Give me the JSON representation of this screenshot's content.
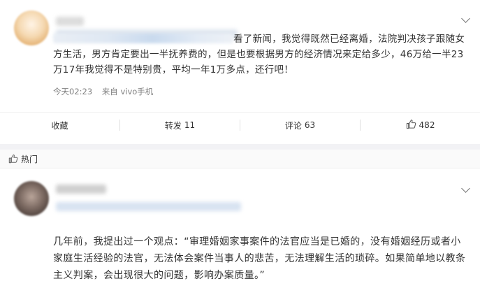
{
  "post": {
    "text_visible": "看了新闻，我觉得既然已经离婚，法院判决孩子跟随女方生活，男方肯定要出一半抚养费的，但是也要根据男方的经济情况来定给多少，46万给一半23万17年我觉得不是特别贵，平均一年1万多点，还行吧！",
    "time": "今天02:23",
    "source": "来自 vivo手机"
  },
  "actions": {
    "favorite_label": "收藏",
    "repost_label": "转发",
    "repost_count": "11",
    "comment_label": "评论",
    "comment_count": "63",
    "like_count": "482"
  },
  "hot_section": {
    "label": "热门"
  },
  "comment": {
    "text": "几年前，我提出过一个观点：“审理婚姻家事案件的法官应当是已婚的，没有婚姻经历或者小家庭生活经验的法官，无法体会案件当事人的悲苦，无法理解生活的琐碎。如果简单地以教条主义判案，会出现很大的问题，影响办案质量。”"
  },
  "icons": {
    "menu": "chevron-down-icon",
    "like": "thumbs-up-icon",
    "hot": "thumbs-up-icon"
  },
  "colors": {
    "text": "#333333",
    "meta": "#808080",
    "divider": "#f0f0f0",
    "section_bg": "#fafafa"
  }
}
